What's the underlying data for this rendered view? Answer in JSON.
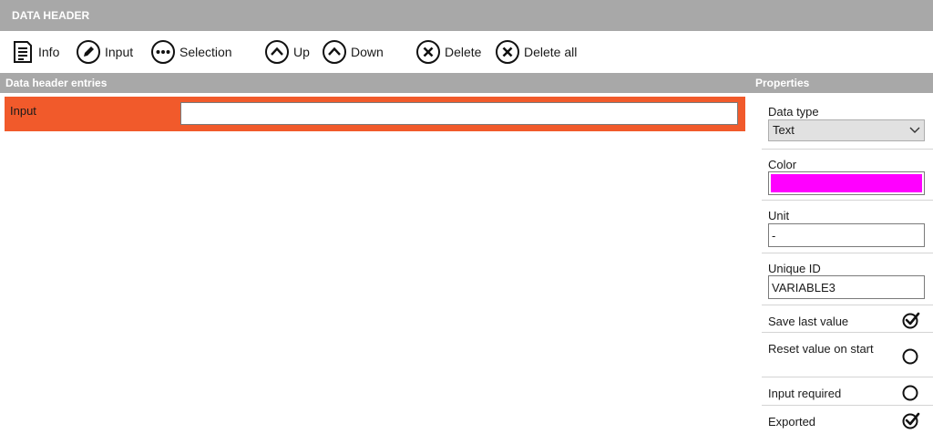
{
  "window": {
    "title": "DATA HEADER"
  },
  "toolbar": {
    "info": "Info",
    "input": "Input",
    "selection": "Selection",
    "up": "Up",
    "down": "Down",
    "delete": "Delete",
    "delete_all": "Delete all"
  },
  "entries": {
    "header": "Data header entries",
    "items": [
      {
        "label": "Input",
        "value": ""
      }
    ]
  },
  "properties": {
    "header": "Properties",
    "data_type": {
      "label": "Data type",
      "value": "Text"
    },
    "color": {
      "label": "Color",
      "value": "#ff00ff"
    },
    "unit": {
      "label": "Unit",
      "value": "-"
    },
    "unique_id": {
      "label": "Unique ID",
      "value": "VARIABLE3"
    },
    "save_last_value": {
      "label": "Save last value",
      "checked": true
    },
    "reset_value_on_start": {
      "label": "Reset value on start",
      "checked": false
    },
    "input_required": {
      "label": "Input required",
      "checked": false
    },
    "exported": {
      "label": "Exported",
      "checked": true
    }
  },
  "colors": {
    "selected_row": "#f15a2b",
    "header_bar": "#a8a8a8"
  }
}
